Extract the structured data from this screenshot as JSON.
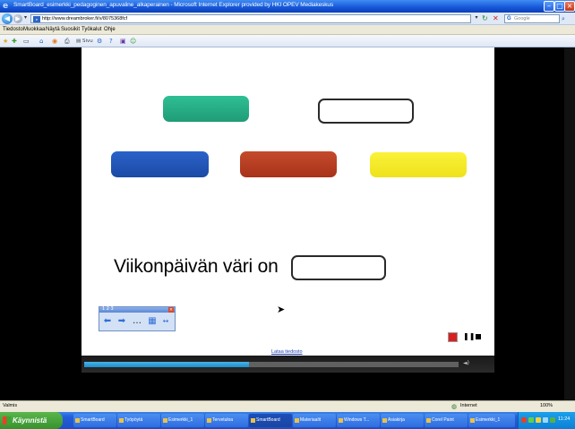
{
  "window": {
    "title": "SmartBoard_esimerkki_pedagoginen_apuvaline_alkaperainen - Microsoft Internet Explorer provided by HKI OPEV Mediakeskus",
    "min": "–",
    "max": "□",
    "close": "×"
  },
  "address": {
    "url": "http://www.dreambroker.fi/v/8075368fcf",
    "search_placeholder": "Google",
    "search_brand": "G"
  },
  "menu": [
    "Tiedosto",
    "Muokkaa",
    "Näytä",
    "Suosikit",
    "Työkalut",
    "Ohje"
  ],
  "toolbar": {
    "page_label": "Sivu",
    "icons": [
      "star-icon",
      "add-favorite-icon",
      "home-icon",
      "feeds-icon",
      "print-icon",
      "page-icon",
      "tools-icon",
      "help-icon",
      "research-icon",
      "messenger-icon"
    ]
  },
  "slide": {
    "question": "Viikonpäivän väri on",
    "colors": {
      "green": "#22a882",
      "blue": "#2255b8",
      "red": "#b53d22",
      "yellow": "#f7ee2a"
    },
    "palette_number": "1 2 3",
    "palette_buttons": [
      "⬅",
      "➡",
      "…",
      "▦",
      "↔"
    ],
    "download_link": "Lataa tiedosto"
  },
  "player": {
    "progress": 0.44,
    "volume_label": "◄)"
  },
  "status": {
    "text": "Valmis",
    "zone": "Internet",
    "zoom": "100%"
  },
  "taskbar": {
    "start": "Käynnistä",
    "tasks": [
      "SmartBoard",
      "Työpöytä",
      "Esimerkki_1",
      "Tervetuloa",
      "SmartBoard",
      "Materiaalit",
      "Windows T...",
      "Asiakirja",
      "Corel Paint",
      "Esimerkki_1"
    ],
    "clock": "11:24"
  }
}
